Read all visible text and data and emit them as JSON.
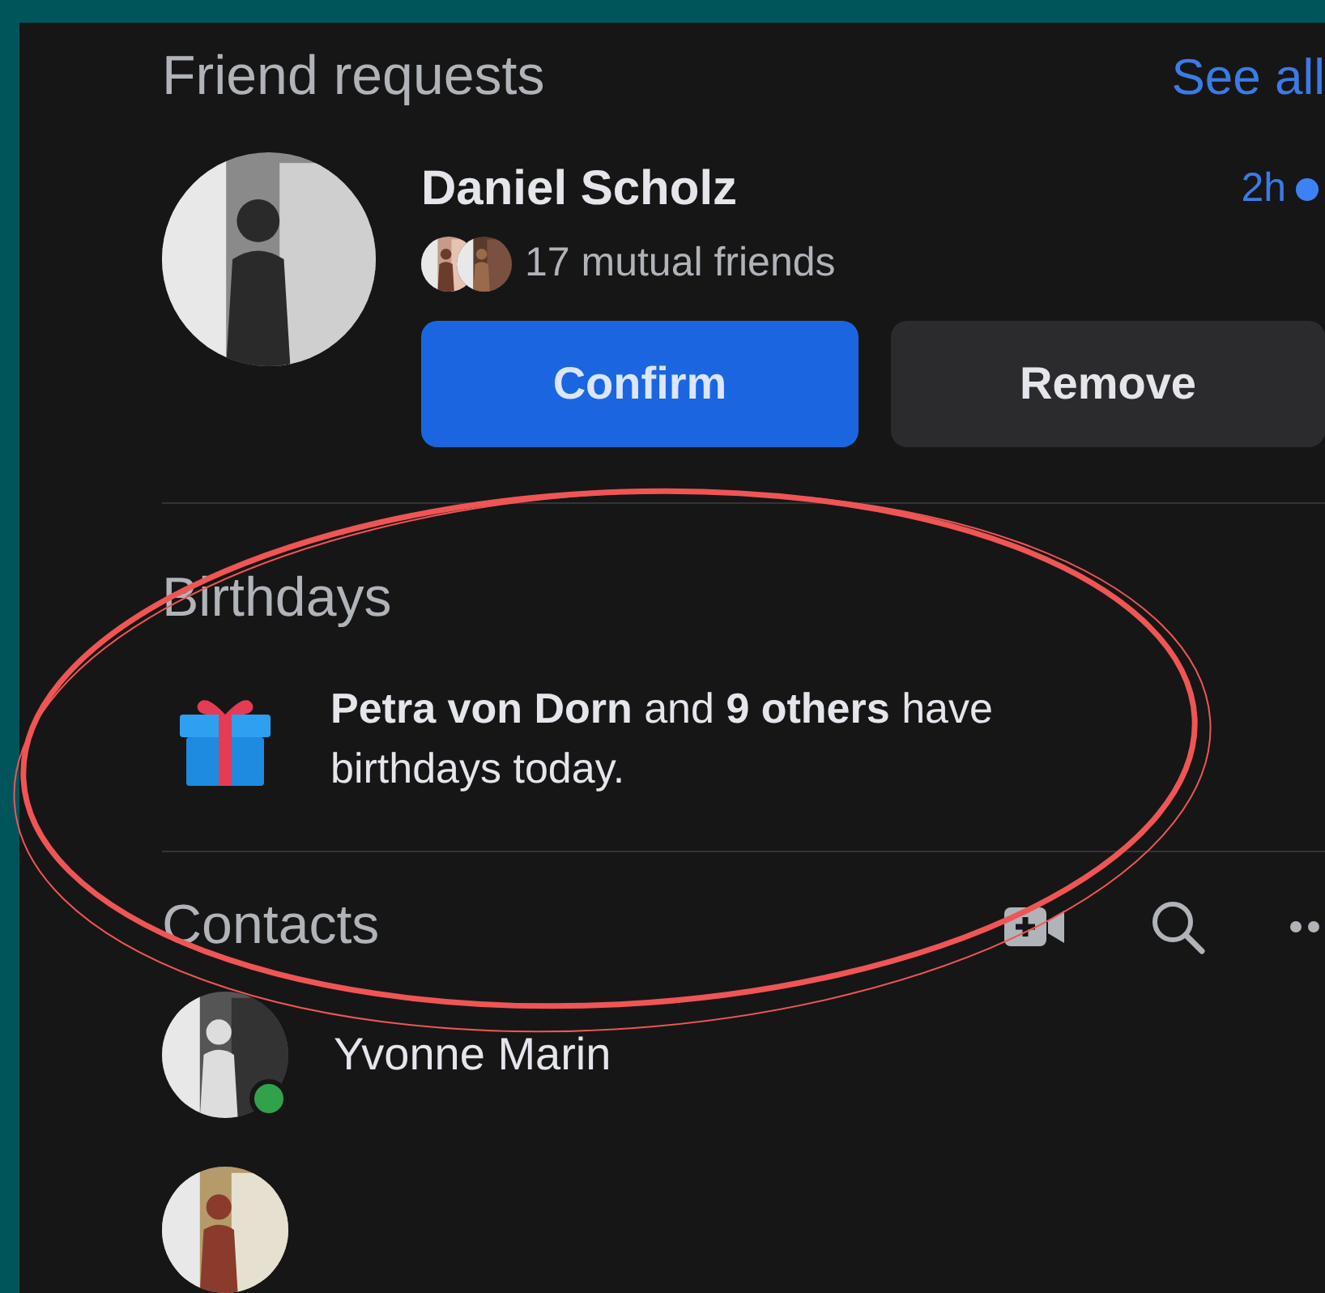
{
  "friend_requests": {
    "title": "Friend requests",
    "see_all": "See all",
    "request": {
      "name": "Daniel Scholz",
      "time": "2h",
      "unread": true,
      "mutual": "17 mutual friends",
      "confirm": "Confirm",
      "remove": "Remove"
    }
  },
  "birthdays": {
    "title": "Birthdays",
    "text": "**Petra von Dorn** and **9 others** have birthdays today."
  },
  "contacts": {
    "title": "Contacts",
    "items": [
      {
        "name": "Yvonne Marin",
        "online": true
      },
      {
        "kind": "picture"
      }
    ]
  }
}
